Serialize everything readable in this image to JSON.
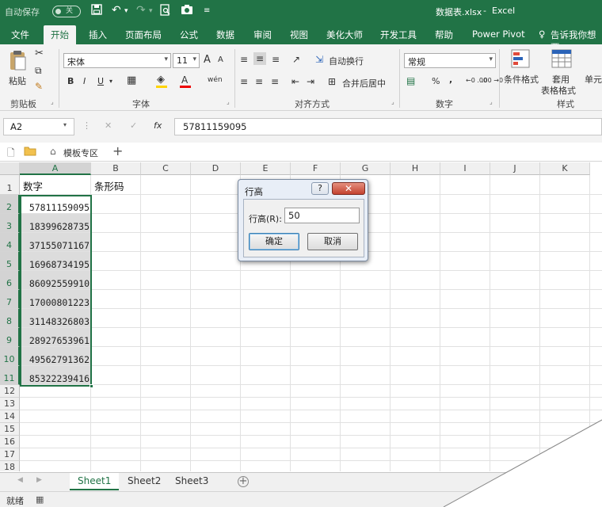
{
  "titlebar": {
    "autosave_label": "自动保存",
    "autosave_state": "关",
    "filename": "数据表.xlsx",
    "separator": "-",
    "app": "Excel"
  },
  "menu": {
    "tabs": [
      "文件",
      "开始",
      "插入",
      "页面布局",
      "公式",
      "数据",
      "审阅",
      "视图",
      "美化大师",
      "开发工具",
      "帮助",
      "Power Pivot"
    ],
    "active": "开始",
    "tell_me": "告诉我你想要"
  },
  "ribbon": {
    "paste_label": "粘贴",
    "clipboard_label": "剪贴板",
    "font_name": "宋体",
    "font_size": "11",
    "font_grow": "A",
    "font_shrink": "A",
    "bold": "B",
    "italic": "I",
    "underline": "U",
    "font_color": "A",
    "phonetic": "wén",
    "font_group_label": "字体",
    "wrap_text": "自动换行",
    "merge_center": "合并后居中",
    "alignment_label": "对齐方式",
    "number_format": "常规",
    "percent": "%",
    "comma": ",",
    "dec_inc": "←0 .00",
    "dec_dec": ".00 →0",
    "number_label": "数字",
    "conditional_format": "条件格式",
    "table_format": [
      "套用",
      "表格格式"
    ],
    "cell_styles": "单元",
    "styles_label": "样式",
    "accent": "#217346"
  },
  "formula_bar": {
    "name_box": "A2",
    "cancel": "✕",
    "enter": "✓",
    "fx": "fx",
    "formula": "57811159095"
  },
  "template_bar": {
    "template_zone": "模板专区",
    "add": "+"
  },
  "sheet": {
    "columns": [
      "A",
      "B",
      "C",
      "D",
      "E",
      "F",
      "G",
      "H",
      "I",
      "J",
      "K"
    ],
    "rows": [
      "1",
      "2",
      "3",
      "4",
      "5",
      "6",
      "7",
      "8",
      "9",
      "10",
      "11",
      "12",
      "13",
      "14",
      "15",
      "16",
      "17",
      "18"
    ],
    "header_a1": "数字",
    "header_b1": "条形码",
    "values": [
      "57811159095",
      "18399628735",
      "37155071167",
      "16968734195",
      "86092559910",
      "17000801223",
      "31148326803",
      "28927653961",
      "49562791362",
      "85322239416"
    ]
  },
  "dialog": {
    "title": "行高",
    "help": "?",
    "close": "✕",
    "field_label": "行高(R):",
    "field_value": "50",
    "ok": "确定",
    "cancel": "取消"
  },
  "tabs": {
    "sheets": [
      "Sheet1",
      "Sheet2",
      "Sheet3"
    ],
    "active": "Sheet1",
    "add": "+"
  },
  "status": {
    "text": "就绪"
  }
}
